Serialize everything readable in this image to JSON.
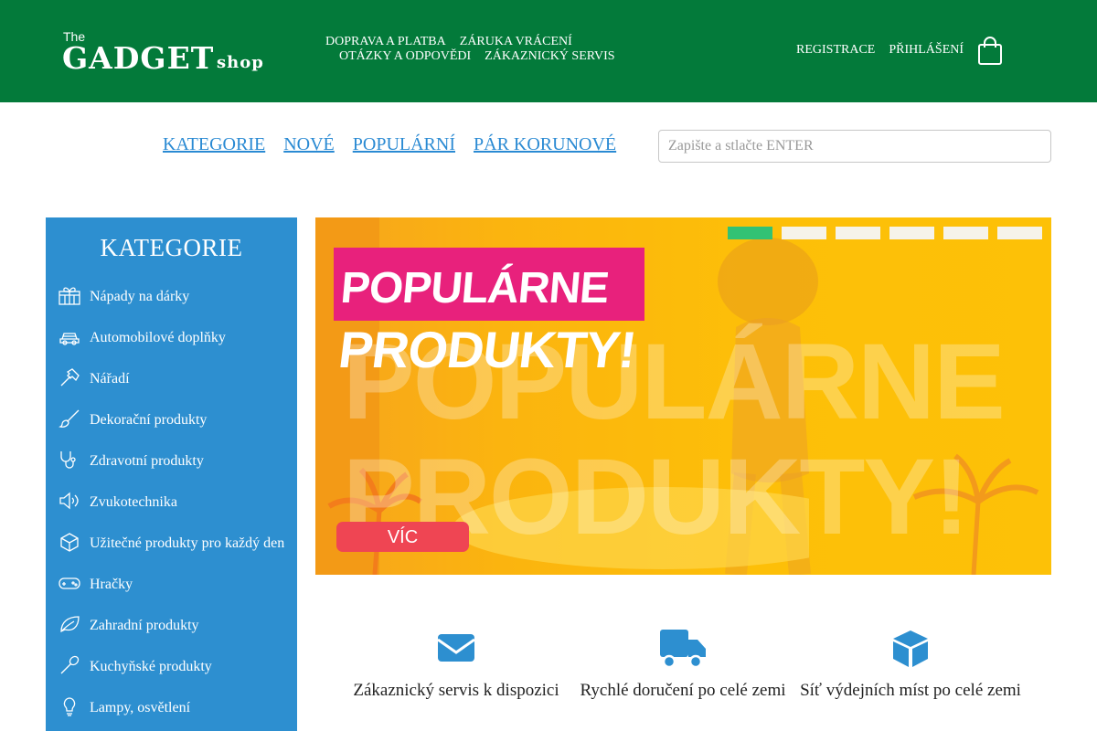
{
  "header": {
    "logo": {
      "the": "The",
      "gadget": "GADGET",
      "shop": "shop"
    },
    "links_row1": [
      "DOPRAVA A PLATBA",
      "ZÁRUKA VRÁCENÍ"
    ],
    "links_row2": [
      "OTÁZKY A ODPOVĚDI",
      "ZÁKAZNICKÝ SERVIS"
    ],
    "register": "REGISTRACE",
    "login": "PŘIHLÁŠENÍ",
    "cart_icon": "shopping-bag-icon",
    "bg_color": "#037a3a"
  },
  "nav": {
    "items": [
      "KATEGORIE",
      "NOVÉ",
      "POPULÁRNÍ",
      "PÁR KORUNOVÉ"
    ],
    "search_placeholder": "Zapište a stlačte ENTER",
    "link_color": "#2a8ad3"
  },
  "sidebar": {
    "title": "KATEGORIE",
    "bg_color": "#2d8fd0",
    "items": [
      {
        "label": "Nápady na dárky",
        "icon": "gift-icon"
      },
      {
        "label": "Automobilové doplňky",
        "icon": "car-icon"
      },
      {
        "label": "Nářadí",
        "icon": "hammer-icon"
      },
      {
        "label": "Dekorační produkty",
        "icon": "brush-icon"
      },
      {
        "label": "Zdravotní produkty",
        "icon": "stethoscope-icon"
      },
      {
        "label": "Zvukotechnika",
        "icon": "speaker-icon"
      },
      {
        "label": "Užitečné produkty pro každý den",
        "icon": "box-icon"
      },
      {
        "label": "Hračky",
        "icon": "gamepad-icon"
      },
      {
        "label": "Zahradní produkty",
        "icon": "leaf-icon"
      },
      {
        "label": "Kuchyňské produkty",
        "icon": "spoon-icon"
      },
      {
        "label": "Lampy, osvětlení",
        "icon": "bulb-icon"
      }
    ]
  },
  "banner": {
    "title1": "POPULÁRNE",
    "title2": "PRODUKTY!",
    "bg_text1": "POPULÁRNE",
    "bg_text2": "PRODUKTY!",
    "button": "VÍC",
    "slides": 6,
    "active_slide": 1
  },
  "features": [
    {
      "icon": "envelope-icon",
      "label": "Zákaznický servis k dispozici"
    },
    {
      "icon": "truck-icon",
      "label": "Rychlé doručení po celé zemi"
    },
    {
      "icon": "cube-icon",
      "label": "Síť výdejních míst po celé zemi"
    }
  ]
}
